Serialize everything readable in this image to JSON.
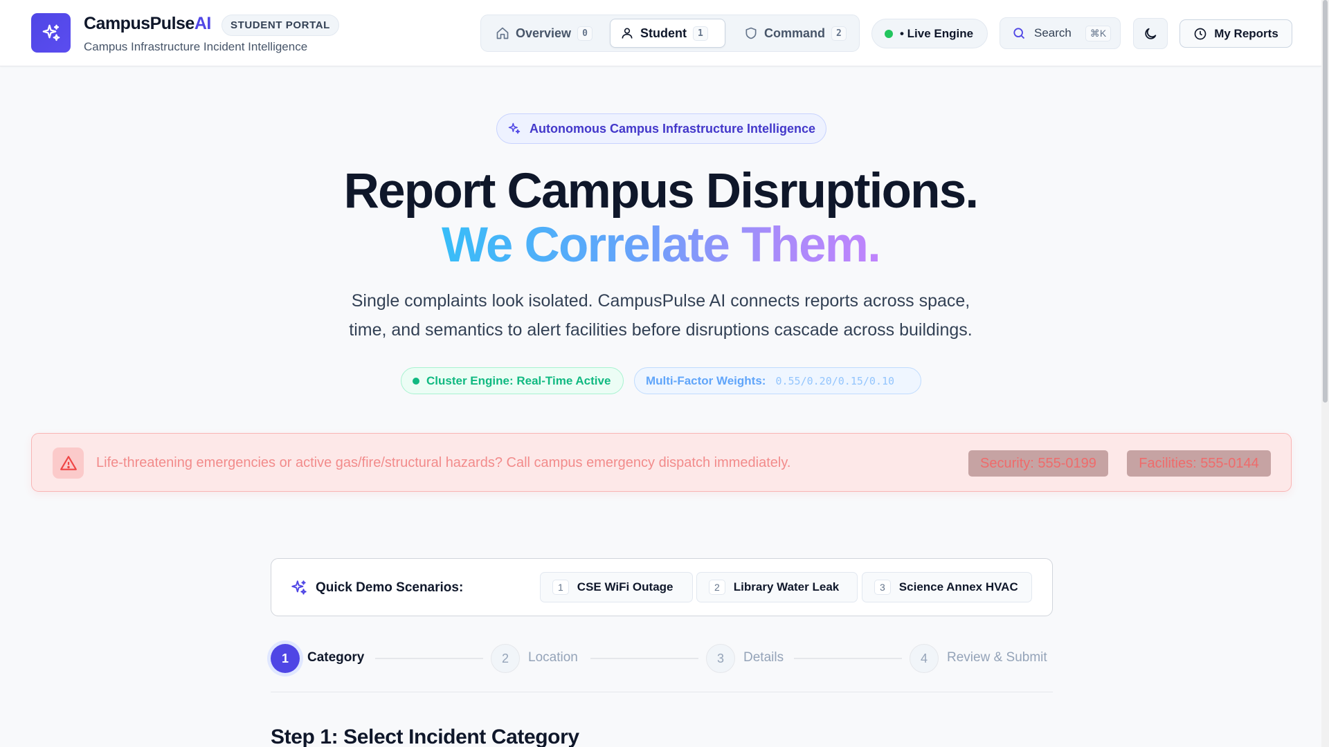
{
  "header": {
    "brand_main": "CampusPulse",
    "brand_ai": "AI",
    "portal_badge": "STUDENT PORTAL",
    "tagline": "Campus Infrastructure Incident Intelligence",
    "nav_tabs": [
      {
        "label": "Overview",
        "shortcut": "0",
        "icon": "home-icon",
        "active": false
      },
      {
        "label": "Student",
        "shortcut": "1",
        "icon": "user-icon",
        "active": true
      },
      {
        "label": "Command",
        "shortcut": "2",
        "icon": "shield-icon",
        "active": false
      }
    ],
    "live_engine": "• Live Engine",
    "search_label": "Search",
    "search_shortcut": "⌘K",
    "theme_icon": "moon-icon",
    "my_reports": "My Reports",
    "my_reports_icon": "clock-icon"
  },
  "hero": {
    "chip": "Autonomous Campus Infrastructure Intelligence",
    "title_line1": "Report Campus Disruptions.",
    "title_line2": "We Correlate Them.",
    "subtitle_line1": "Single complaints look isolated. CampusPulse AI connects reports across space,",
    "subtitle_line2": "time, and semantics to alert facilities before disruptions cascade across buildings.",
    "engine_status": "Cluster Engine: Real-Time Active",
    "weights_label": "Multi-Factor Weights:",
    "weights_value": "0.55/0.20/0.15/0.10"
  },
  "emergency": {
    "icon": "alert-triangle-icon",
    "message": "Life-threatening emergencies or active gas/fire/structural hazards? Call campus emergency dispatch immediately.",
    "security": "Security: 555-0199",
    "facilities": "Facilities: 555-0144"
  },
  "demo": {
    "label": "Quick Demo Scenarios:",
    "scenarios": [
      {
        "key": "1",
        "label": "CSE WiFi Outage"
      },
      {
        "key": "2",
        "label": "Library Water Leak"
      },
      {
        "key": "3",
        "label": "Science Annex HVAC"
      }
    ]
  },
  "stepper": {
    "steps": [
      {
        "num": "1",
        "label": "Category",
        "active": true
      },
      {
        "num": "2",
        "label": "Location",
        "active": false
      },
      {
        "num": "3",
        "label": "Details",
        "active": false
      },
      {
        "num": "4",
        "label": "Review & Submit",
        "active": false
      }
    ]
  },
  "step_heading": "Step 1: Select Incident Category",
  "colors": {
    "accent": "#4f46e5",
    "success": "#10b981",
    "danger": "#ef4444"
  }
}
